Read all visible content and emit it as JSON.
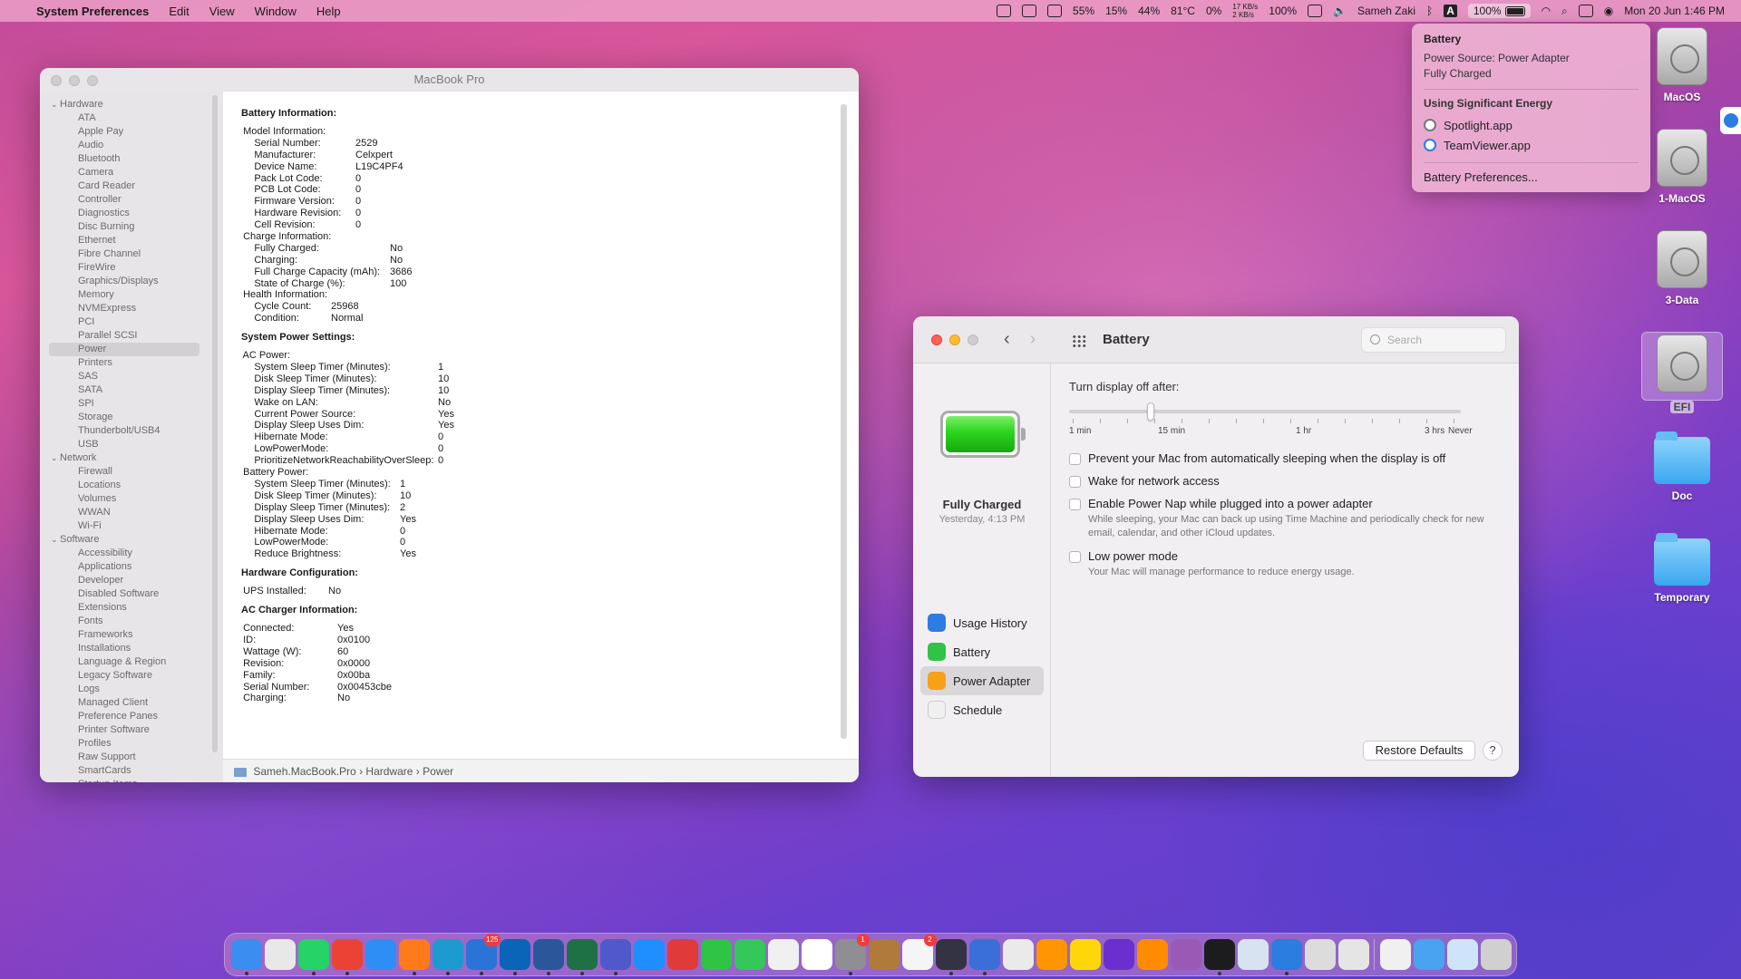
{
  "menubar": {
    "apple": "",
    "app_name": "System Preferences",
    "menus": [
      "Edit",
      "View",
      "Window",
      "Help"
    ],
    "status": {
      "cpu": "55%",
      "mem": "15%",
      "disk": "44%",
      "temp": "81°C",
      "gpu": "0%",
      "net_up": "17 KB/s",
      "net_down": "2 KB/s",
      "battery_a": "100%",
      "user": "Sameh Zaki",
      "keyboard": "A",
      "battery_b": "100%",
      "datetime": "Mon 20 Jun  1:46 PM"
    }
  },
  "battery_menu": {
    "title": "Battery",
    "source": "Power Source: Power Adapter",
    "state": "Fully Charged",
    "energy_header": "Using Significant Energy",
    "apps": [
      "Spotlight.app",
      "TeamViewer.app"
    ],
    "prefs": "Battery Preferences..."
  },
  "sysinfo": {
    "title": "MacBook Pro",
    "sidebar": [
      {
        "type": "cat",
        "label": "Hardware"
      },
      {
        "type": "it",
        "label": "ATA"
      },
      {
        "type": "it",
        "label": "Apple Pay"
      },
      {
        "type": "it",
        "label": "Audio"
      },
      {
        "type": "it",
        "label": "Bluetooth"
      },
      {
        "type": "it",
        "label": "Camera"
      },
      {
        "type": "it",
        "label": "Card Reader"
      },
      {
        "type": "it",
        "label": "Controller"
      },
      {
        "type": "it",
        "label": "Diagnostics"
      },
      {
        "type": "it",
        "label": "Disc Burning"
      },
      {
        "type": "it",
        "label": "Ethernet"
      },
      {
        "type": "it",
        "label": "Fibre Channel"
      },
      {
        "type": "it",
        "label": "FireWire"
      },
      {
        "type": "it",
        "label": "Graphics/Displays"
      },
      {
        "type": "it",
        "label": "Memory"
      },
      {
        "type": "it",
        "label": "NVMExpress"
      },
      {
        "type": "it",
        "label": "PCI"
      },
      {
        "type": "it",
        "label": "Parallel SCSI"
      },
      {
        "type": "sel",
        "label": "Power"
      },
      {
        "type": "it",
        "label": "Printers"
      },
      {
        "type": "it",
        "label": "SAS"
      },
      {
        "type": "it",
        "label": "SATA"
      },
      {
        "type": "it",
        "label": "SPI"
      },
      {
        "type": "it",
        "label": "Storage"
      },
      {
        "type": "it",
        "label": "Thunderbolt/USB4"
      },
      {
        "type": "it",
        "label": "USB"
      },
      {
        "type": "cat",
        "label": "Network"
      },
      {
        "type": "it",
        "label": "Firewall"
      },
      {
        "type": "it",
        "label": "Locations"
      },
      {
        "type": "it",
        "label": "Volumes"
      },
      {
        "type": "it",
        "label": "WWAN"
      },
      {
        "type": "it",
        "label": "Wi-Fi"
      },
      {
        "type": "cat",
        "label": "Software"
      },
      {
        "type": "it",
        "label": "Accessibility"
      },
      {
        "type": "it",
        "label": "Applications"
      },
      {
        "type": "it",
        "label": "Developer"
      },
      {
        "type": "it",
        "label": "Disabled Software"
      },
      {
        "type": "it",
        "label": "Extensions"
      },
      {
        "type": "it",
        "label": "Fonts"
      },
      {
        "type": "it",
        "label": "Frameworks"
      },
      {
        "type": "it",
        "label": "Installations"
      },
      {
        "type": "it",
        "label": "Language & Region"
      },
      {
        "type": "it",
        "label": "Legacy Software"
      },
      {
        "type": "it",
        "label": "Logs"
      },
      {
        "type": "it",
        "label": "Managed Client"
      },
      {
        "type": "it",
        "label": "Preference Panes"
      },
      {
        "type": "it",
        "label": "Printer Software"
      },
      {
        "type": "it",
        "label": "Profiles"
      },
      {
        "type": "it",
        "label": "Raw Support"
      },
      {
        "type": "it",
        "label": "SmartCards"
      },
      {
        "type": "it",
        "label": "Startup Items"
      }
    ],
    "content": [
      {
        "sec": "Battery Information:"
      },
      {
        "k": "  Model Information:",
        "v": ""
      },
      {
        "k": "      Serial Number:",
        "v": "2529",
        "w": 110
      },
      {
        "k": "      Manufacturer:",
        "v": "Celxpert",
        "w": 110
      },
      {
        "k": "      Device Name:",
        "v": "L19C4PF4",
        "w": 110
      },
      {
        "k": "      Pack Lot Code:",
        "v": "0",
        "w": 110
      },
      {
        "k": "      PCB Lot Code:",
        "v": "0",
        "w": 110
      },
      {
        "k": "      Firmware Version:",
        "v": "0",
        "w": 110
      },
      {
        "k": "      Hardware Revision:",
        "v": "0",
        "w": 110
      },
      {
        "k": "      Cell Revision:",
        "v": "0",
        "w": 110
      },
      {
        "k": "  Charge Information:",
        "v": ""
      },
      {
        "k": "      Fully Charged:",
        "v": "No",
        "w": 148
      },
      {
        "k": "      Charging:",
        "v": "No",
        "w": 148
      },
      {
        "k": "      Full Charge Capacity (mAh):",
        "v": "3686",
        "w": 148
      },
      {
        "k": "      State of Charge (%):",
        "v": "100",
        "w": 148
      },
      {
        "k": "  Health Information:",
        "v": ""
      },
      {
        "k": "      Cycle Count:",
        "v": "25968",
        "w": 83
      },
      {
        "k": "      Condition:",
        "v": "Normal",
        "w": 83
      },
      {
        "sec": "System Power Settings:"
      },
      {
        "k": "  AC Power:",
        "v": ""
      },
      {
        "k": "      System Sleep Timer (Minutes):",
        "v": "1",
        "w": 201
      },
      {
        "k": "      Disk Sleep Timer (Minutes):",
        "v": "10",
        "w": 201
      },
      {
        "k": "      Display Sleep Timer (Minutes):",
        "v": "10",
        "w": 201
      },
      {
        "k": "      Wake on LAN:",
        "v": "No",
        "w": 201
      },
      {
        "k": "      Current Power Source:",
        "v": "Yes",
        "w": 201
      },
      {
        "k": "      Display Sleep Uses Dim:",
        "v": "Yes",
        "w": 201
      },
      {
        "k": "      Hibernate Mode:",
        "v": "0",
        "w": 201
      },
      {
        "k": "      LowPowerMode:",
        "v": "0",
        "w": 201
      },
      {
        "k": "      PrioritizeNetworkReachabilityOverSleep:",
        "v": "0",
        "w": 201
      },
      {
        "k": "  Battery Power:",
        "v": ""
      },
      {
        "k": "      System Sleep Timer (Minutes):",
        "v": "1",
        "w": 159
      },
      {
        "k": "      Disk Sleep Timer (Minutes):",
        "v": "10",
        "w": 159
      },
      {
        "k": "      Display Sleep Timer (Minutes):",
        "v": "2",
        "w": 159
      },
      {
        "k": "      Display Sleep Uses Dim:",
        "v": "Yes",
        "w": 159
      },
      {
        "k": "      Hibernate Mode:",
        "v": "0",
        "w": 159
      },
      {
        "k": "      LowPowerMode:",
        "v": "0",
        "w": 159
      },
      {
        "k": "      Reduce Brightness:",
        "v": "Yes",
        "w": 159
      },
      {
        "sec": "Hardware Configuration:"
      },
      {
        "k": "  UPS Installed:",
        "v": "No",
        "w": 80
      },
      {
        "sec": "AC Charger Information:"
      },
      {
        "k": "  Connected:",
        "v": "Yes",
        "w": 90
      },
      {
        "k": "  ID:",
        "v": "0x0100",
        "w": 90
      },
      {
        "k": "  Wattage (W):",
        "v": "60",
        "w": 90
      },
      {
        "k": "  Revision:",
        "v": "0x0000",
        "w": 90
      },
      {
        "k": "  Family:",
        "v": "0x00ba",
        "w": 90
      },
      {
        "k": "  Serial Number:",
        "v": "0x00453cbe",
        "w": 90
      },
      {
        "k": "  Charging:",
        "v": "No",
        "w": 90
      }
    ],
    "path": [
      "Sameh.MacBook.Pro",
      "Hardware",
      "Power"
    ]
  },
  "prefs": {
    "title": "Battery",
    "search_placeholder": "Search",
    "status": "Fully Charged",
    "status_time": "Yesterday, 4:13 PM",
    "nav": [
      {
        "label": "Usage History",
        "color": "#2b7de0"
      },
      {
        "label": "Battery",
        "color": "#2fc446"
      },
      {
        "label": "Power Adapter",
        "color": "#f7a11b"
      },
      {
        "label": "Schedule",
        "color": "#f0f0f0"
      }
    ],
    "selected_nav": 2,
    "display_off_label": "Turn display off after:",
    "slider_labels": [
      "1 min",
      "15 min",
      "1 hr",
      "3 hrs",
      "Never"
    ],
    "slider_value": "15 min",
    "options": [
      {
        "label": "Prevent your Mac from automatically sleeping when the display is off",
        "sub": ""
      },
      {
        "label": "Wake for network access",
        "sub": ""
      },
      {
        "label": "Enable Power Nap while plugged into a power adapter",
        "sub": "While sleeping, your Mac can back up using Time Machine and periodically check for new email, calendar, and other iCloud updates."
      },
      {
        "label": "Low power mode",
        "sub": "Your Mac will manage performance to reduce energy usage."
      }
    ],
    "restore": "Restore Defaults",
    "help": "?"
  },
  "desktop": [
    {
      "label": "MacOS",
      "kind": "disk"
    },
    {
      "label": "1-MacOS",
      "kind": "disk"
    },
    {
      "label": "3-Data",
      "kind": "disk"
    },
    {
      "label": "EFI",
      "kind": "disk-sel"
    },
    {
      "label": "Doc",
      "kind": "folder"
    },
    {
      "label": "Temporary",
      "kind": "folder"
    }
  ],
  "dock": [
    {
      "c": "#3a8ef0",
      "dot": true
    },
    {
      "c": "#e8e8e8"
    },
    {
      "c": "#25d366",
      "dot": true
    },
    {
      "c": "#ea4335",
      "dot": true
    },
    {
      "c": "#2f8ef5"
    },
    {
      "c": "#ff7a1a",
      "dot": true
    },
    {
      "c": "#1d9bd1",
      "dot": true
    },
    {
      "c": "#2a74d8",
      "dot": true,
      "badge": "125"
    },
    {
      "c": "#0a64b8",
      "dot": true
    },
    {
      "c": "#2b579a",
      "dot": true
    },
    {
      "c": "#1e7145",
      "dot": true
    },
    {
      "c": "#5059c9",
      "dot": true
    },
    {
      "c": "#1f8fff"
    },
    {
      "c": "#e03a3a"
    },
    {
      "c": "#2fc446"
    },
    {
      "c": "#34c759"
    },
    {
      "c": "#f0f0f0"
    },
    {
      "c": "#ffffff"
    },
    {
      "c": "#8e8e93",
      "dot": true,
      "badge": "1"
    },
    {
      "c": "#b07a3a"
    },
    {
      "c": "#f5f5f5",
      "badge": "2"
    },
    {
      "c": "#333344",
      "dot": true
    },
    {
      "c": "#3a6fd8",
      "dot": true
    },
    {
      "c": "#eaeaea"
    },
    {
      "c": "#ff9500"
    },
    {
      "c": "#ffd60a"
    },
    {
      "c": "#6b2fd0"
    },
    {
      "c": "#ff8c00"
    },
    {
      "c": "#9b59b6"
    },
    {
      "c": "#1c1c1e",
      "dot": true
    },
    {
      "c": "#d7e3f0"
    },
    {
      "c": "#2b7de0",
      "dot": true
    },
    {
      "c": "#dcdcdc"
    },
    {
      "c": "#e5e5e5"
    },
    {
      "sep": true
    },
    {
      "c": "#f0f0f0"
    },
    {
      "c": "#4aa3f0"
    },
    {
      "c": "#cfe4fa"
    },
    {
      "c": "#d0d0d0"
    }
  ]
}
